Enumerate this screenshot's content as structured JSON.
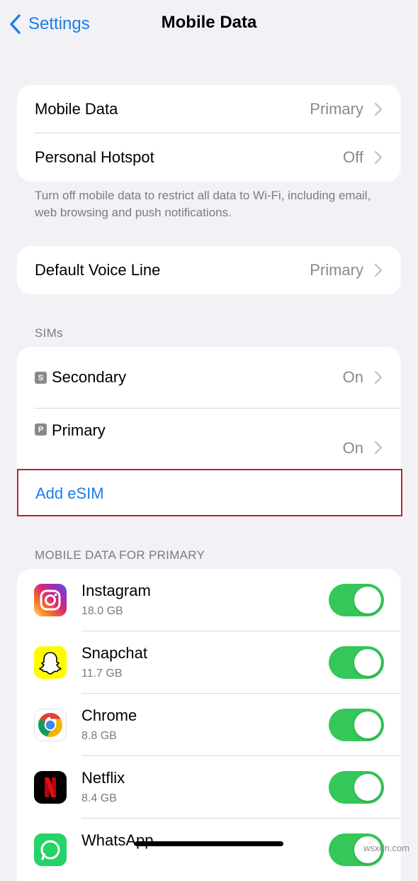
{
  "nav": {
    "back_label": "Settings",
    "title": "Mobile Data"
  },
  "general": {
    "rows": [
      {
        "label": "Mobile Data",
        "value": "Primary"
      },
      {
        "label": "Personal Hotspot",
        "value": "Off"
      }
    ],
    "footer": "Turn off mobile data to restrict all data to Wi-Fi, including email, web browsing and push notifications."
  },
  "voice": {
    "label": "Default Voice Line",
    "value": "Primary"
  },
  "sims": {
    "header": "SIMs",
    "items": [
      {
        "badge": "S",
        "label": "Secondary",
        "value": "On"
      },
      {
        "badge": "P",
        "label": "Primary",
        "value": "On"
      }
    ],
    "add_esim": "Add eSIM"
  },
  "apps_section": {
    "header": "MOBILE DATA FOR PRIMARY",
    "apps": [
      {
        "name": "Instagram",
        "size": "18.0 GB",
        "enabled": true,
        "icon": "instagram-icon"
      },
      {
        "name": "Snapchat",
        "size": "11.7 GB",
        "enabled": true,
        "icon": "snapchat-icon"
      },
      {
        "name": "Chrome",
        "size": "8.8 GB",
        "enabled": true,
        "icon": "chrome-icon"
      },
      {
        "name": "Netflix",
        "size": "8.4 GB",
        "enabled": true,
        "icon": "netflix-icon"
      },
      {
        "name": "WhatsApp",
        "size": "",
        "enabled": true,
        "icon": "whatsapp-icon"
      }
    ]
  },
  "watermark": "wsxdn.com",
  "colors": {
    "accent": "#1a7ee8",
    "toggle_on": "#34c759",
    "highlight_border": "#b5282d"
  }
}
